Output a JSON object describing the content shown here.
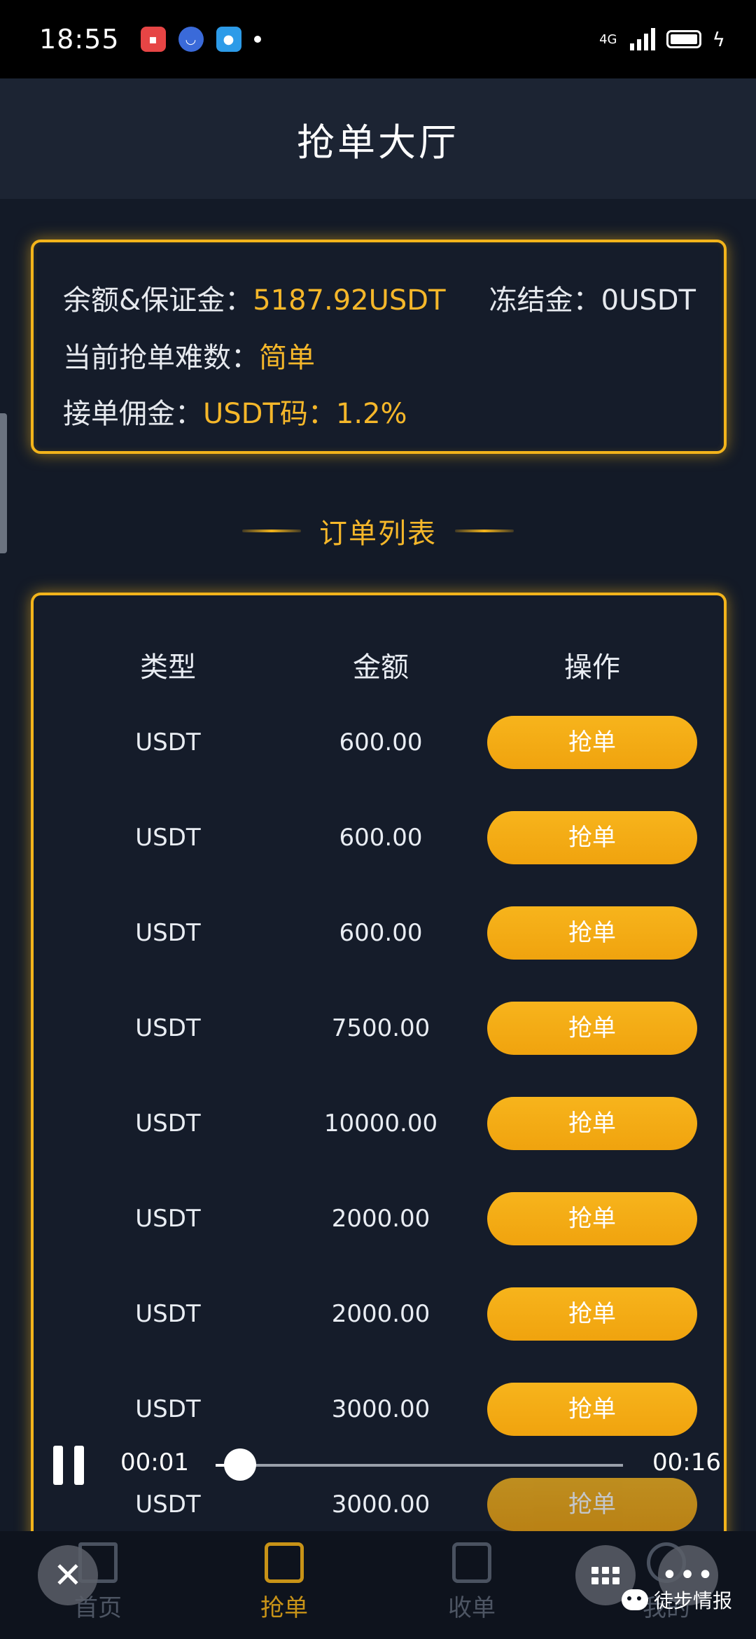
{
  "status_bar": {
    "time": "18:55",
    "network": "4G"
  },
  "header": {
    "title": "抢单大厅"
  },
  "info": {
    "balance_label": "余额&保证金：",
    "balance_value": "5187.92USDT",
    "frozen_label": "冻结金：",
    "frozen_value": "0USDT",
    "difficulty_label": "当前抢单难数：",
    "difficulty_value": "简单",
    "commission_label": "接单佣金：",
    "commission_value": "USDT码：1.2%"
  },
  "orders": {
    "section_title": "订单列表",
    "columns": [
      "类型",
      "金额",
      "操作"
    ],
    "rows": [
      {
        "type": "USDT",
        "amount": "600.00",
        "action": "抢单"
      },
      {
        "type": "USDT",
        "amount": "600.00",
        "action": "抢单"
      },
      {
        "type": "USDT",
        "amount": "600.00",
        "action": "抢单"
      },
      {
        "type": "USDT",
        "amount": "7500.00",
        "action": "抢单"
      },
      {
        "type": "USDT",
        "amount": "10000.00",
        "action": "抢单"
      },
      {
        "type": "USDT",
        "amount": "2000.00",
        "action": "抢单"
      },
      {
        "type": "USDT",
        "amount": "2000.00",
        "action": "抢单"
      },
      {
        "type": "USDT",
        "amount": "3000.00",
        "action": "抢单"
      },
      {
        "type": "USDT",
        "amount": "3000.00",
        "action": "抢单"
      }
    ]
  },
  "video": {
    "current_time": "00:01",
    "total_time": "00:16",
    "progress": 0.06
  },
  "nav": {
    "items": [
      {
        "label": "首页",
        "icon": "home-icon"
      },
      {
        "label": "抢单",
        "icon": "grab-order-icon",
        "active": true
      },
      {
        "label": "收单",
        "icon": "receive-order-icon"
      },
      {
        "label": "我的",
        "icon": "profile-icon"
      }
    ]
  },
  "watermark": {
    "text": "徒步情报"
  },
  "colors": {
    "accent": "#f3b41b",
    "background": "#131a27",
    "button": "#f5a915"
  }
}
